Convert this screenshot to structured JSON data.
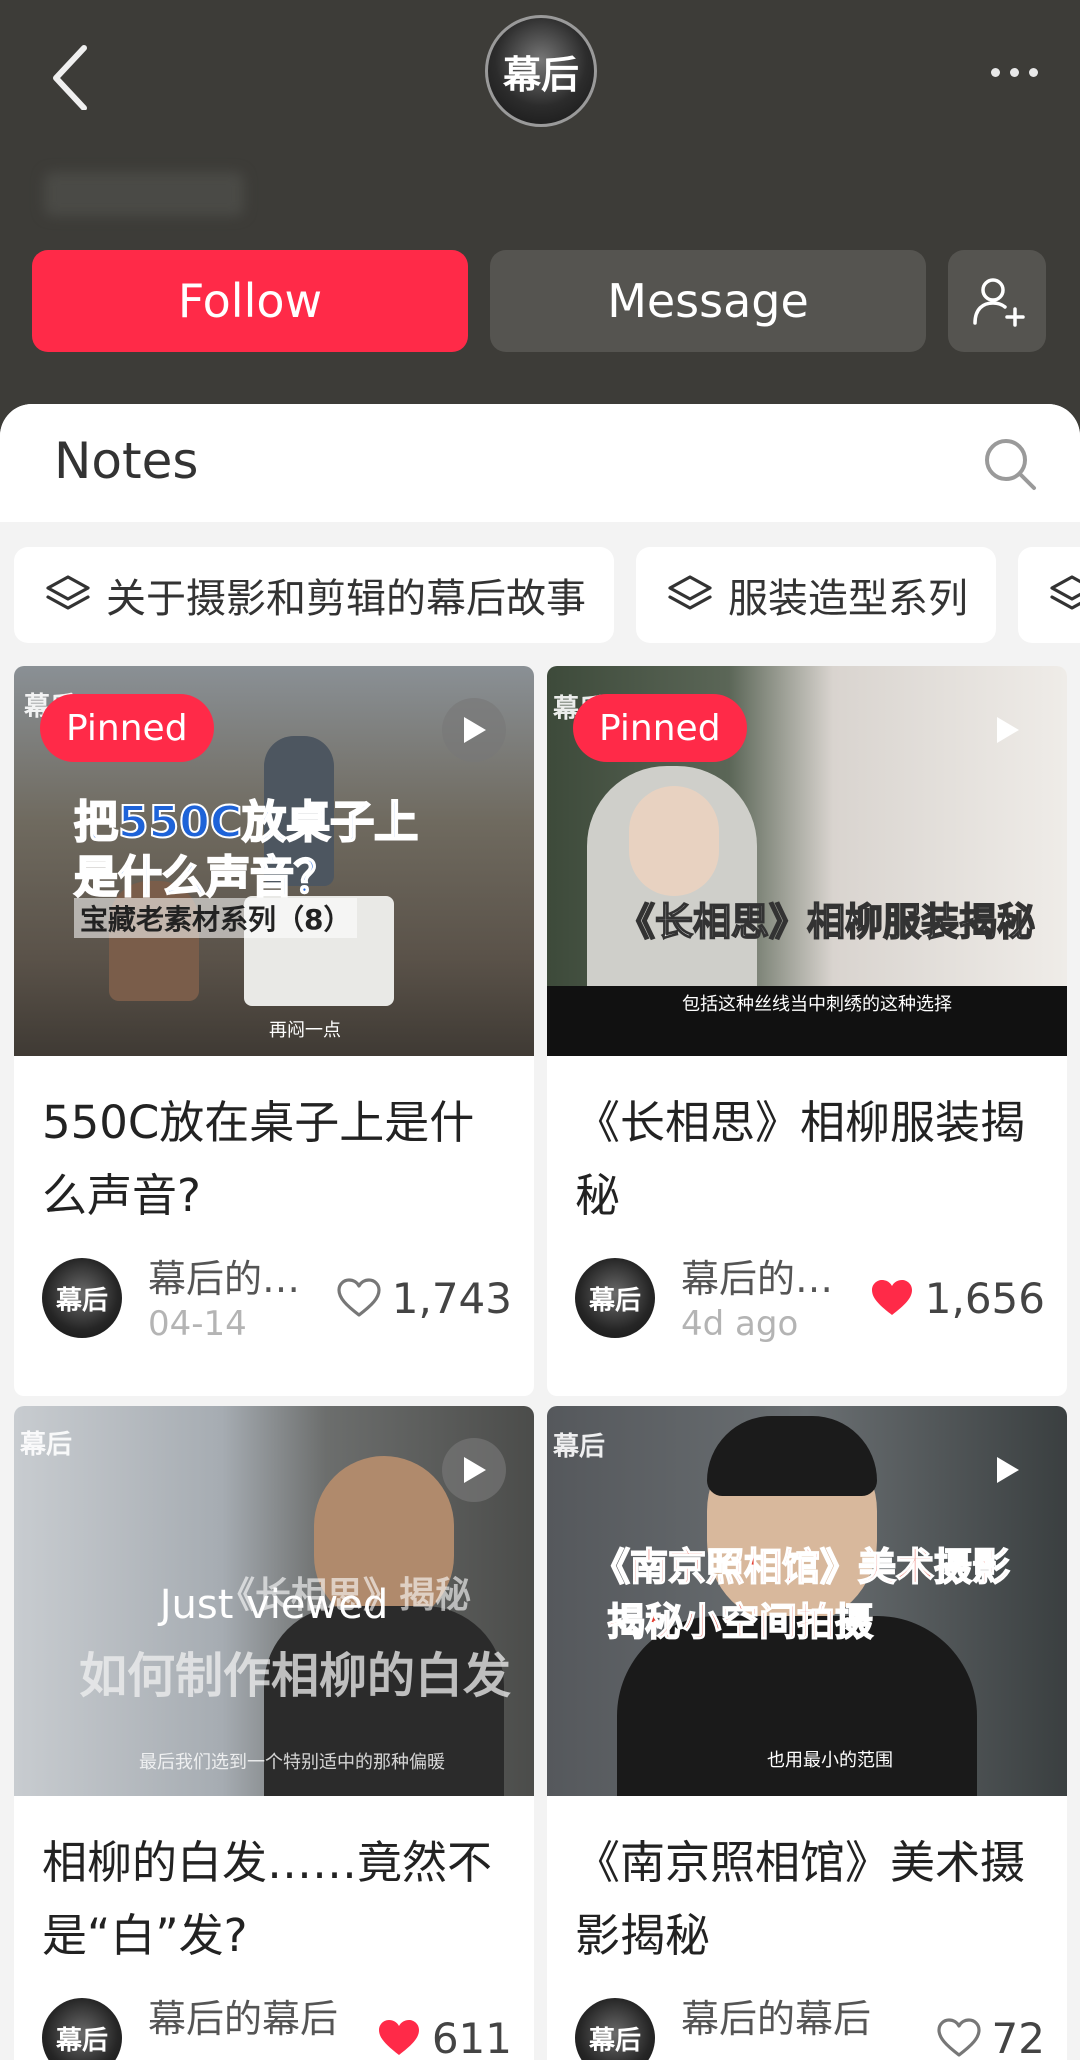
{
  "profile": {
    "avatar_text": "幕后"
  },
  "actions": {
    "follow_label": "Follow",
    "message_label": "Message"
  },
  "notes": {
    "title": "Notes"
  },
  "collections": [
    {
      "label": "关于摄影和剪辑的幕后故事"
    },
    {
      "label": "服装造型系列"
    }
  ],
  "cards": [
    {
      "badge": "Pinned",
      "thumb_text_1": "把550C放桌子上",
      "thumb_text_2": "是什么声音？",
      "thumb_text_3": "宝藏老素材系列（8）",
      "thumb_subtitle": "再闷一点",
      "watermark": "幕后",
      "title": "550C放在桌子上是什么声音?",
      "author": "幕后的…",
      "date": "04-14",
      "likes": "1,743",
      "liked": false
    },
    {
      "badge": "Pinned",
      "thumb_text_1": "《长相思》相柳服装揭秘",
      "thumb_subtitle": "包括这种丝线当中刺绣的这种选择",
      "watermark": "幕后",
      "title": "《长相思》相柳服装揭秘",
      "author": "幕后的…",
      "date": "4d ago",
      "likes": "1,656",
      "liked": true
    },
    {
      "status": "Just viewed",
      "thumb_text_1": "《长相思》揭秘",
      "thumb_text_2": "如何制作相柳的白发",
      "thumb_subtitle": "最后我们选到一个特别适中的那种偏暖",
      "watermark": "幕后",
      "title": "相柳的白发……竟然不是“白”发?",
      "author": "幕后的幕后",
      "likes": "611",
      "liked": true
    },
    {
      "thumb_text_1": "《南京照相馆》美术摄影",
      "thumb_text_2": "揭秘小空间拍摄",
      "thumb_subtitle": "也用最小的范围",
      "watermark": "幕后",
      "title": "《南京照相馆》美术摄影揭秘",
      "author": "幕后的幕后",
      "likes": "72",
      "liked": false
    }
  ],
  "colors": {
    "accent": "#ff2a48",
    "header_bg": "#3d3c38"
  }
}
